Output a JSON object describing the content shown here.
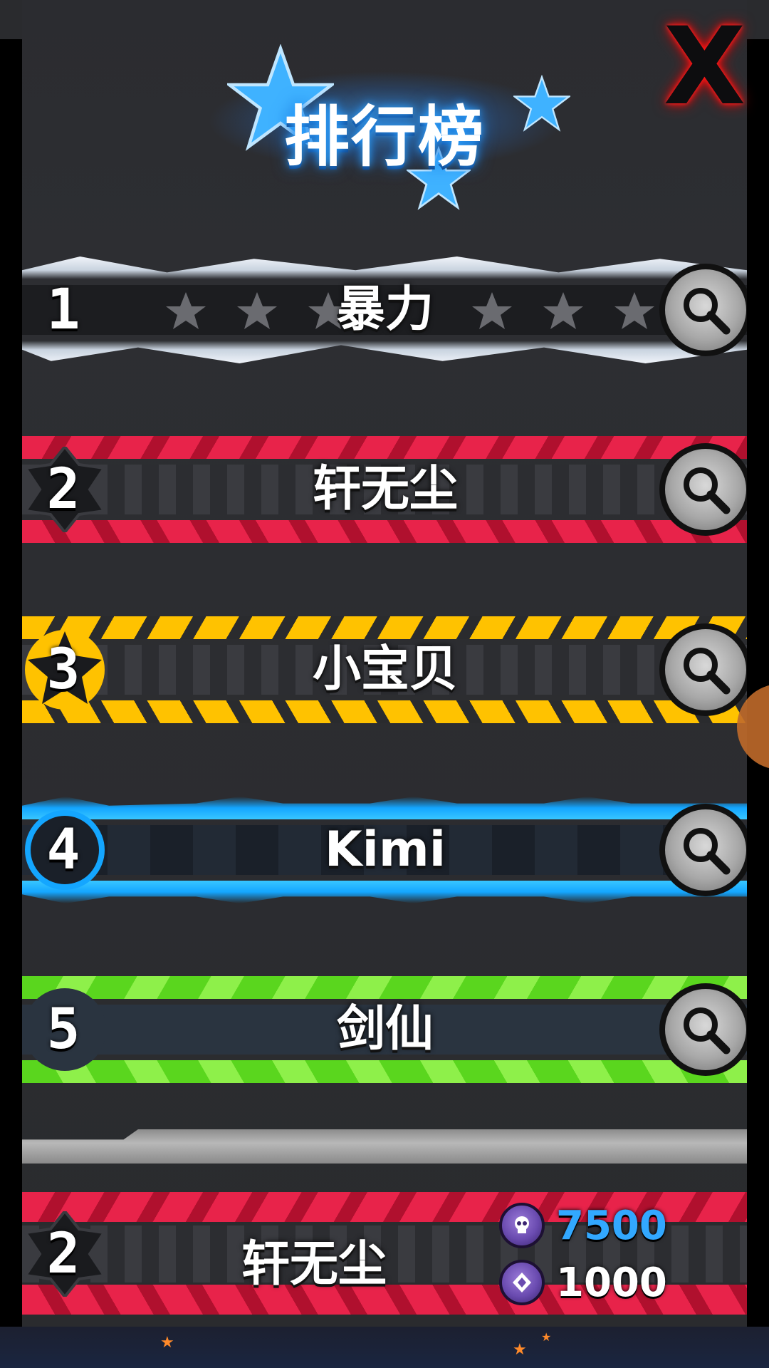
{
  "header": {
    "title": "排行榜",
    "close_label": "X"
  },
  "leaderboard": [
    {
      "rank": "1",
      "name": "暴力",
      "theme": "silver-lightning",
      "colors": {
        "band": "#e8eef5",
        "accent": "#ffffff"
      }
    },
    {
      "rank": "2",
      "name": "轩无尘",
      "theme": "red",
      "colors": {
        "band": "#e8234a",
        "accent": "#ff5a78"
      }
    },
    {
      "rank": "3",
      "name": "小宝贝",
      "theme": "gold",
      "colors": {
        "band": "#ffc200",
        "accent": "#ffe35a"
      }
    },
    {
      "rank": "4",
      "name": "Kimi",
      "theme": "blue",
      "colors": {
        "band": "#14a6ff",
        "accent": "#38c6ff"
      }
    },
    {
      "rank": "5",
      "name": "剑仙",
      "theme": "green",
      "colors": {
        "band": "#5ad61e",
        "accent": "#9bf04a"
      }
    }
  ],
  "my_entry": {
    "rank": "2",
    "name": "轩无尘",
    "score": "7500",
    "gems": "1000",
    "colors": {
      "band": "#e8234a",
      "score": "#32a8ff",
      "gems": "#ffffff"
    }
  },
  "icons": {
    "search": "magnifier-icon",
    "score": "skull-coin-icon",
    "gems": "gem-coin-icon",
    "close": "close-x-icon"
  }
}
